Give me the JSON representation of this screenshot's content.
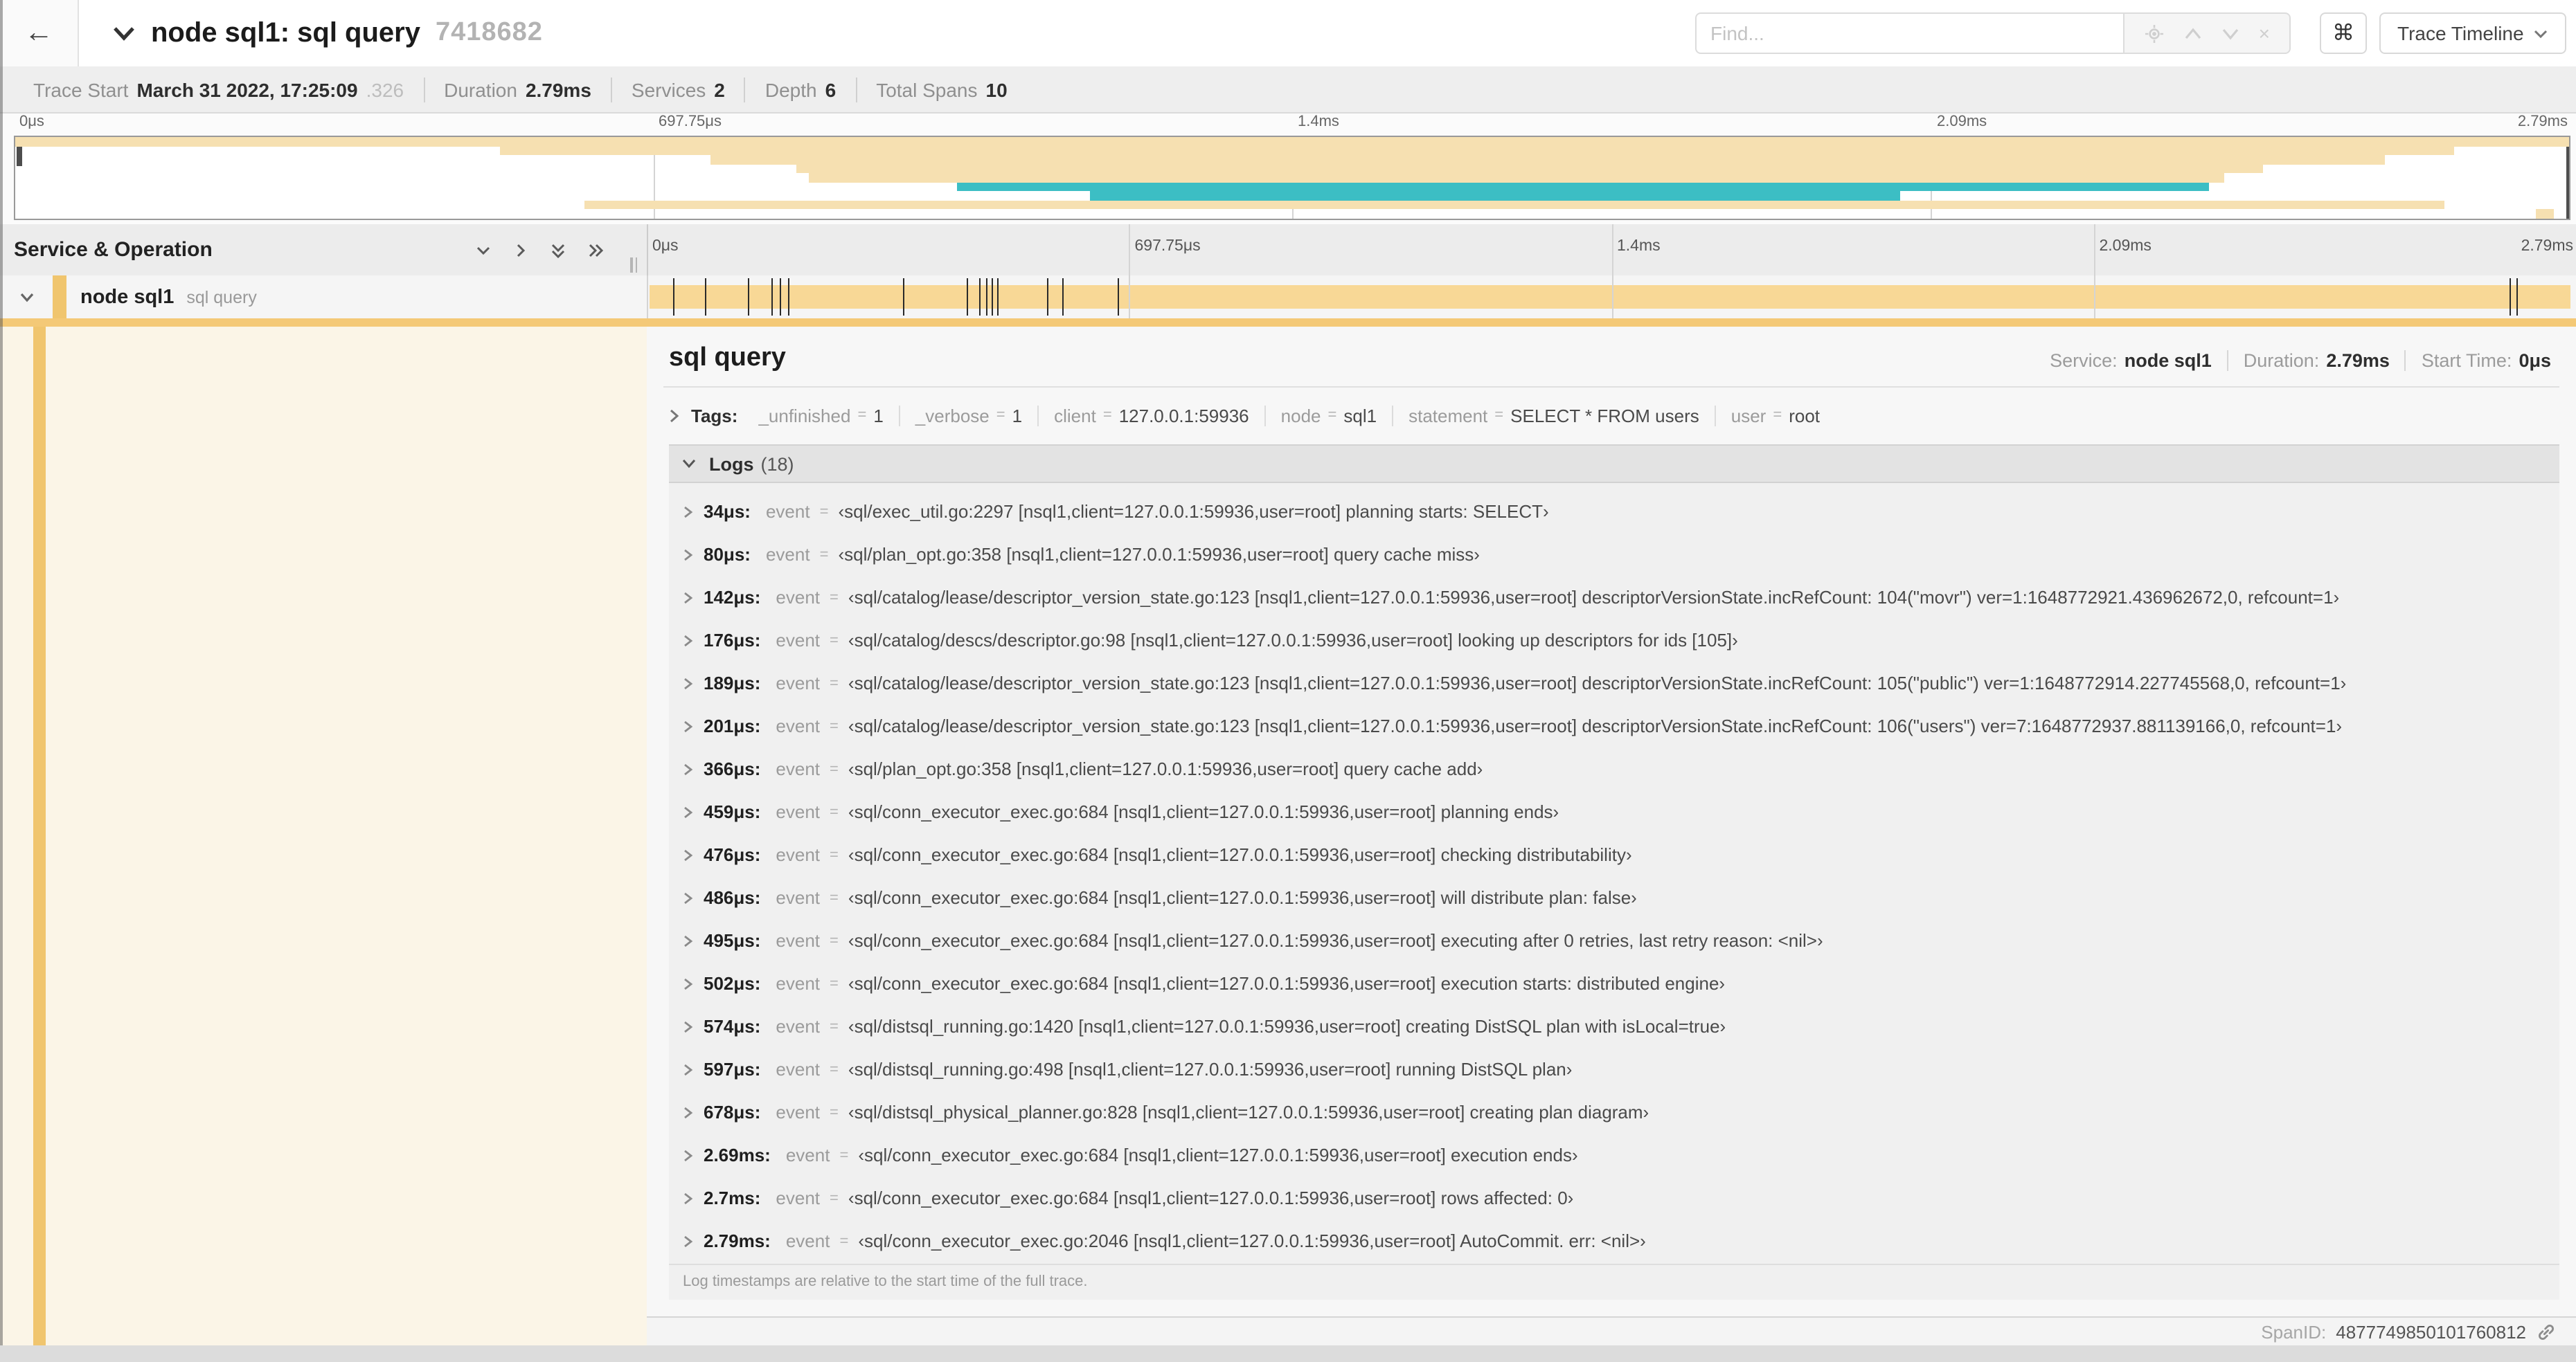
{
  "icons": {
    "back": "←",
    "command": "⌘",
    "close": "×"
  },
  "header": {
    "title": "node sql1: sql query",
    "trace_id": "7418682",
    "find_placeholder": "Find...",
    "view_button": "Trace Timeline"
  },
  "summary": {
    "items": [
      {
        "label": "Trace Start",
        "value": "March 31 2022, 17:25:09",
        "suffix": ".326"
      },
      {
        "label": "Duration",
        "value": "2.79ms"
      },
      {
        "label": "Services",
        "value": "2"
      },
      {
        "label": "Depth",
        "value": "6"
      },
      {
        "label": "Total Spans",
        "value": "10"
      }
    ]
  },
  "timeline": {
    "ticks": [
      "0μs",
      "697.75μs",
      "1.4ms",
      "2.09ms",
      "2.79ms"
    ],
    "gridlines_pct": [
      0,
      25,
      50,
      75
    ],
    "colors": {
      "tan": "#F6E0B1",
      "teal": "#3CBEC4",
      "span_bar": "#F8D896",
      "accent": "#F4C977",
      "strip": "#F0C56E",
      "left_col": "#FBF5E7"
    },
    "minimap_bars": [
      {
        "row": 0,
        "start": 0,
        "end": 100,
        "color": "tan"
      },
      {
        "row": 1,
        "start": 19.0,
        "end": 95.5,
        "color": "tan"
      },
      {
        "row": 2,
        "start": 27.2,
        "end": 92.8,
        "color": "tan"
      },
      {
        "row": 3,
        "start": 30.6,
        "end": 88.0,
        "color": "tan"
      },
      {
        "row": 4,
        "start": 31.1,
        "end": 86.5,
        "color": "tan"
      },
      {
        "row": 5,
        "start": 36.9,
        "end": 85.9,
        "color": "teal"
      },
      {
        "row": 6,
        "start": 42.1,
        "end": 73.8,
        "color": "teal"
      },
      {
        "row": 7,
        "start": 22.3,
        "end": 95.1,
        "color": "tan"
      },
      {
        "row": 8,
        "start": 98.7,
        "end": 99.4,
        "color": "tan"
      }
    ]
  },
  "gantt": {
    "header": "Service & Operation",
    "row": {
      "service": "node sql1",
      "operation": "sql query"
    },
    "markers_pct": [
      1.22,
      2.87,
      5.09,
      6.31,
      6.77,
      7.2,
      13.12,
      16.45,
      17.06,
      17.42,
      17.74,
      18.0,
      20.57,
      21.4,
      24.3,
      96.42,
      96.77
    ]
  },
  "detail": {
    "title": "sql query",
    "meta": [
      {
        "label": "Service:",
        "value": "node sql1"
      },
      {
        "label": "Duration:",
        "value": "2.79ms"
      },
      {
        "label": "Start Time:",
        "value": "0μs"
      }
    ],
    "tags": {
      "label": "Tags:",
      "eq": "=",
      "pairs": [
        {
          "k": "_unfinished",
          "v": "1"
        },
        {
          "k": "_verbose",
          "v": "1"
        },
        {
          "k": "client",
          "v": "127.0.0.1:59936"
        },
        {
          "k": "node",
          "v": "sql1"
        },
        {
          "k": "statement",
          "v": "SELECT * FROM users"
        },
        {
          "k": "user",
          "v": "root"
        }
      ]
    },
    "logs": {
      "label": "Logs",
      "count": "(18)",
      "key_label": "event",
      "eq": "=",
      "rows": [
        {
          "t": "34μs:",
          "v": "‹sql/exec_util.go:2297 [nsql1,client=127.0.0.1:59936,user=root] planning starts: SELECT›"
        },
        {
          "t": "80μs:",
          "v": "‹sql/plan_opt.go:358 [nsql1,client=127.0.0.1:59936,user=root] query cache miss›"
        },
        {
          "t": "142μs:",
          "v": "‹sql/catalog/lease/descriptor_version_state.go:123 [nsql1,client=127.0.0.1:59936,user=root] descriptorVersionState.incRefCount: 104(\"movr\") ver=1:1648772921.436962672,0, refcount=1›"
        },
        {
          "t": "176μs:",
          "v": "‹sql/catalog/descs/descriptor.go:98 [nsql1,client=127.0.0.1:59936,user=root] looking up descriptors for ids [105]›"
        },
        {
          "t": "189μs:",
          "v": "‹sql/catalog/lease/descriptor_version_state.go:123 [nsql1,client=127.0.0.1:59936,user=root] descriptorVersionState.incRefCount: 105(\"public\") ver=1:1648772914.227745568,0, refcount=1›"
        },
        {
          "t": "201μs:",
          "v": "‹sql/catalog/lease/descriptor_version_state.go:123 [nsql1,client=127.0.0.1:59936,user=root] descriptorVersionState.incRefCount: 106(\"users\") ver=7:1648772937.881139166,0, refcount=1›"
        },
        {
          "t": "366μs:",
          "v": "‹sql/plan_opt.go:358 [nsql1,client=127.0.0.1:59936,user=root] query cache add›"
        },
        {
          "t": "459μs:",
          "v": "‹sql/conn_executor_exec.go:684 [nsql1,client=127.0.0.1:59936,user=root] planning ends›"
        },
        {
          "t": "476μs:",
          "v": "‹sql/conn_executor_exec.go:684 [nsql1,client=127.0.0.1:59936,user=root] checking distributability›"
        },
        {
          "t": "486μs:",
          "v": "‹sql/conn_executor_exec.go:684 [nsql1,client=127.0.0.1:59936,user=root] will distribute plan: false›"
        },
        {
          "t": "495μs:",
          "v": "‹sql/conn_executor_exec.go:684 [nsql1,client=127.0.0.1:59936,user=root] executing after 0 retries, last retry reason: <nil>›"
        },
        {
          "t": "502μs:",
          "v": "‹sql/conn_executor_exec.go:684 [nsql1,client=127.0.0.1:59936,user=root] execution starts: distributed engine›"
        },
        {
          "t": "574μs:",
          "v": "‹sql/distsql_running.go:1420 [nsql1,client=127.0.0.1:59936,user=root] creating DistSQL plan with isLocal=true›"
        },
        {
          "t": "597μs:",
          "v": "‹sql/distsql_running.go:498 [nsql1,client=127.0.0.1:59936,user=root] running DistSQL plan›"
        },
        {
          "t": "678μs:",
          "v": "‹sql/distsql_physical_planner.go:828 [nsql1,client=127.0.0.1:59936,user=root] creating plan diagram›"
        },
        {
          "t": "2.69ms:",
          "v": "‹sql/conn_executor_exec.go:684 [nsql1,client=127.0.0.1:59936,user=root] execution ends›"
        },
        {
          "t": "2.7ms:",
          "v": "‹sql/conn_executor_exec.go:684 [nsql1,client=127.0.0.1:59936,user=root] rows affected: 0›"
        },
        {
          "t": "2.79ms:",
          "v": "‹sql/conn_executor_exec.go:2046 [nsql1,client=127.0.0.1:59936,user=root] AutoCommit. err: <nil>›"
        }
      ],
      "note": "Log timestamps are relative to the start time of the full trace."
    },
    "span_id_label": "SpanID:",
    "span_id": "4877749850101760812"
  }
}
